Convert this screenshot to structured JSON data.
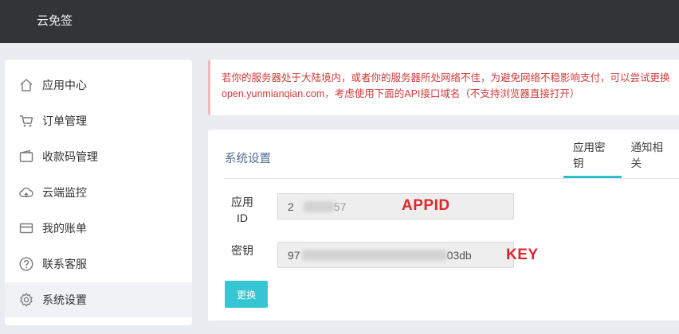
{
  "header": {
    "brand": "云免签"
  },
  "sidebar": {
    "items": [
      {
        "label": "应用中心",
        "icon": "home-icon"
      },
      {
        "label": "订单管理",
        "icon": "cart-icon"
      },
      {
        "label": "收款码管理",
        "icon": "wallet-icon"
      },
      {
        "label": "云端监控",
        "icon": "cloud-icon"
      },
      {
        "label": "我的账单",
        "icon": "card-icon"
      },
      {
        "label": "联系客服",
        "icon": "help-icon"
      },
      {
        "label": "系统设置",
        "icon": "gear-icon",
        "active": true
      }
    ]
  },
  "notice": {
    "line1": "若你的服务器处于大陆境内，或者你的服务器所处网络不佳，为避免网络不稳影响支付，可以尝试更换",
    "line2": "open.yunmianqian.com，考虑使用下面的API接口域名（不支持浏览器直接打开）"
  },
  "panel": {
    "title": "系统设置",
    "tabs": [
      {
        "label": "应用密钥",
        "active": true
      },
      {
        "label": "通知相关"
      }
    ],
    "fields": {
      "appid_label_line1": "应用",
      "appid_label_line2": "ID",
      "appid_prefix": "2",
      "appid_suffix": "57",
      "key_label": "密钥",
      "key_prefix": "97",
      "key_suffix": "03db"
    },
    "annotations": {
      "appid": "APPID",
      "key": "KEY"
    },
    "submit_label": "更换"
  },
  "colors": {
    "topbar": "#333437",
    "accent": "#2cbfc9",
    "button": "#36c6d3",
    "notice_text": "#d23a3a",
    "annotation": "#e0262b"
  }
}
